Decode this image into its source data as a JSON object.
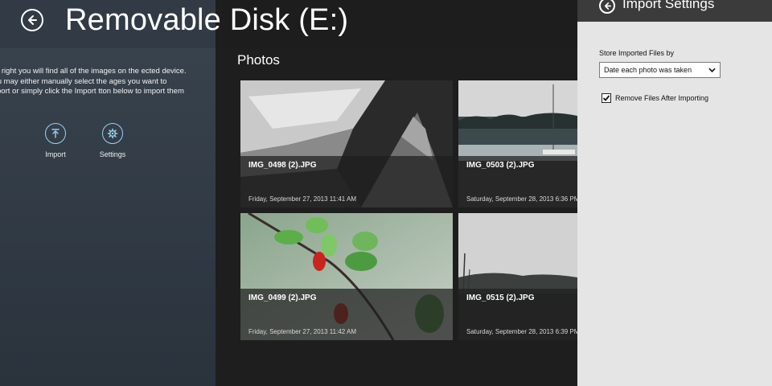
{
  "app": {
    "title": "Removable Disk (E:)"
  },
  "left_panel": {
    "intro": "the right you will find all of the images on the ected device. You may either manually select the ages you want to import or simply click the Import tton below to import them all.",
    "actions": [
      {
        "label": "Import",
        "icon": "import-icon"
      },
      {
        "label": "Settings",
        "icon": "gear-icon"
      }
    ]
  },
  "photos": {
    "heading": "Photos",
    "items": [
      {
        "filename": "IMG_0498 (2).JPG",
        "date": "Friday, September 27, 2013 11:41 AM"
      },
      {
        "filename": "IMG_0503 (2).JPG",
        "date": "Saturday, September 28, 2013 6:36 PM"
      },
      {
        "filename": "IMG_0499 (2).JPG",
        "date": "Friday, September 27, 2013 11:42 AM"
      },
      {
        "filename": "IMG_0515 (2).JPG",
        "date": "Saturday, September 28, 2013 6:39 PM"
      }
    ]
  },
  "settings": {
    "title": "Import Settings",
    "store_label": "Store Imported Files by",
    "store_value": "Date each photo was taken",
    "remove_label": "Remove Files After Importing",
    "remove_checked": true
  },
  "colors": {
    "accent": "#9ad0ef",
    "panel": "#e5e5e5",
    "settings_header": "#3b3b3b"
  }
}
